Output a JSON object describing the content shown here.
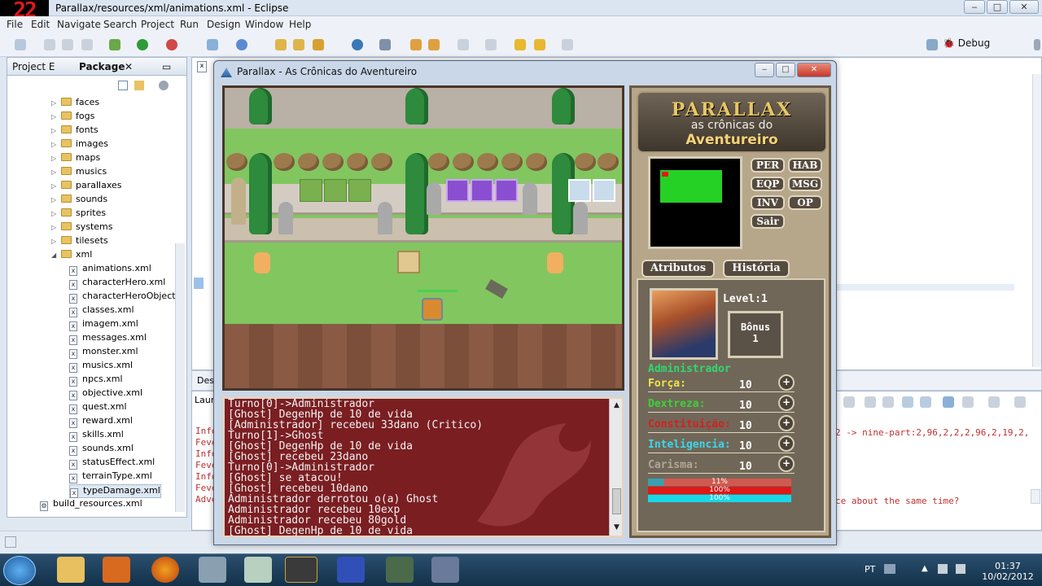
{
  "frame_counter": "22",
  "window": {
    "title": "Parallax/resources/xml/animations.xml - Eclipse",
    "minimize": "‒",
    "maximize": "□",
    "close": "✕"
  },
  "menu": [
    "File",
    "Edit",
    "Navigate",
    "Search",
    "Project",
    "Run",
    "Design",
    "Window",
    "Help"
  ],
  "perspective": {
    "label": "Debug"
  },
  "left_panel": {
    "tabs": [
      "Project E",
      "Package"
    ],
    "folders": [
      "faces",
      "fogs",
      "fonts",
      "images",
      "maps",
      "musics",
      "parallaxes",
      "sounds",
      "sprites",
      "systems",
      "tilesets",
      "xml"
    ],
    "xml_files": [
      "animations.xml",
      "characterHero.xml",
      "characterHeroObjectiv",
      "classes.xml",
      "imagem.xml",
      "messages.xml",
      "monster.xml",
      "musics.xml",
      "npcs.xml",
      "objective.xml",
      "quest.xml",
      "reward.xml",
      "skills.xml",
      "sounds.xml",
      "statusEffect.xml",
      "terrainType.xml",
      "typeDamage.xml"
    ],
    "selected_file": "typeDamage.xml",
    "extra_file": "build_resources.xml"
  },
  "editor": {
    "bottom_tab_stub": "Desi",
    "launch_stub": "Laun",
    "console_lines": [
      "Info",
      "Feve",
      "Info",
      "Feve",
      "Info",
      "Feve",
      "Adve"
    ],
    "console_right_1": "2 -> nine-part:2,96,2,2,2,96,2,19,2,",
    "console_right_2": "ce about the same time?"
  },
  "game": {
    "title": "Parallax - As Crônicas do Aventureiro",
    "log": [
      "Turno[0]->Administrador",
      "[Ghost] DegenHp de 10 de vida",
      "[Administrador] recebeu 33dano (Critico)",
      "Turno[1]->Ghost",
      "[Ghost] DegenHp de 10 de vida",
      "[Ghost] recebeu 23dano",
      "Turno[0]->Administrador",
      "[Ghost] se atacou!",
      "[Ghost] recebeu 10dano",
      "Administrador derrotou o(a) Ghost",
      "Administrador recebeu 10exp",
      "Administrador recebeu 80gold",
      "[Ghost] DegenHp de 10 de vida"
    ],
    "logo": {
      "title": "PARALLAX",
      "subtitle": "as crônicas do",
      "subtitle2": "Aventureiro"
    },
    "menu_buttons": [
      "PER",
      "HAB",
      "EQP",
      "MSG",
      "INV",
      "OP",
      "Sair"
    ],
    "tabs": [
      "Atributos",
      "História"
    ],
    "level_label": "Level:1",
    "bonus_label": "Bônus",
    "bonus_value": "1",
    "character_name": "Administrador",
    "stats": [
      {
        "label": "Força:",
        "value": "10",
        "color": "#f2e24a"
      },
      {
        "label": "Dextreza:",
        "value": "10",
        "color": "#39d439"
      },
      {
        "label": "Constituição:",
        "value": "10",
        "color": "#d81e1e"
      },
      {
        "label": "Inteligencia:",
        "value": "10",
        "color": "#39d8ee"
      },
      {
        "label": "Carisma:",
        "value": "10",
        "color": "#b0a894"
      }
    ],
    "bars": [
      {
        "label": "11%",
        "value": 0.11,
        "color": "#d05a50",
        "fill": "#3aa0b0"
      },
      {
        "label": "100%",
        "value": 1.0,
        "color": "#e01818"
      },
      {
        "label": "100%",
        "value": 1.0,
        "color": "#18d8e8"
      }
    ],
    "plus_label": "+"
  },
  "taskbar": {
    "lang": "PT",
    "time": "01:37",
    "date": "10/02/2012"
  }
}
